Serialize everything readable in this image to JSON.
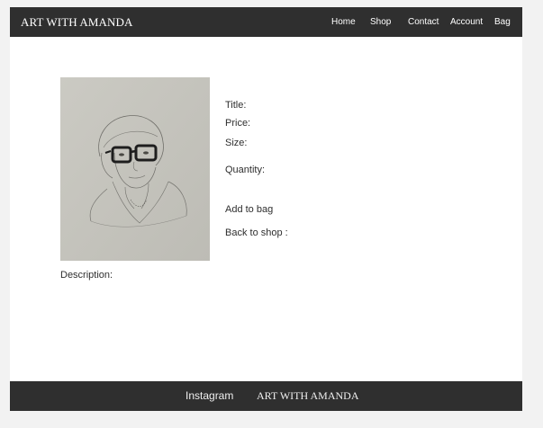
{
  "nav": {
    "brand": "ART WITH AMANDA",
    "links": [
      {
        "label": "Home"
      },
      {
        "label": "Shop"
      },
      {
        "label": "Contact"
      },
      {
        "label": "Account"
      },
      {
        "label": "Bag"
      }
    ]
  },
  "product": {
    "image_icon": "portrait-sketch-image",
    "title_label": "Title:",
    "price_label": "Price:",
    "size_label": "Size:",
    "quantity_label": "Quantity:",
    "add_to_bag_label": "Add to bag",
    "back_to_shop_label": "Back to shop :",
    "description_label": "Description:"
  },
  "footer": {
    "instagram_label": "Instagram",
    "brand": "ART WITH AMANDA"
  },
  "colors": {
    "bar_background": "#2f2f2f",
    "page_background": "#ffffff",
    "outer_background": "#f2f2f2",
    "image_paper": "#c5c4bd"
  }
}
